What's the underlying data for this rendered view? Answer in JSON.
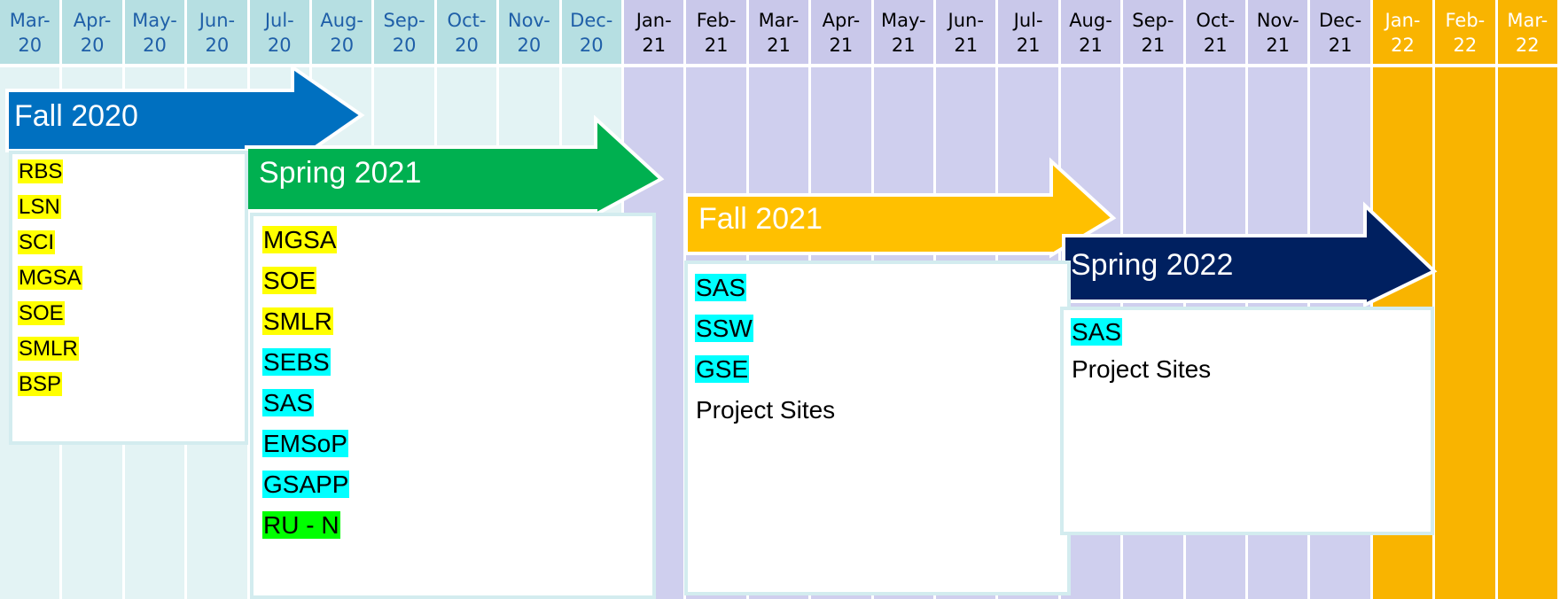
{
  "months": [
    {
      "m": "Mar-",
      "y": "20",
      "period": "2020"
    },
    {
      "m": "Apr-",
      "y": "20",
      "period": "2020"
    },
    {
      "m": "May-",
      "y": "20",
      "period": "2020"
    },
    {
      "m": "Jun-",
      "y": "20",
      "period": "2020"
    },
    {
      "m": "Jul-",
      "y": "20",
      "period": "2020"
    },
    {
      "m": "Aug-",
      "y": "20",
      "period": "2020"
    },
    {
      "m": "Sep-",
      "y": "20",
      "period": "2020"
    },
    {
      "m": "Oct-",
      "y": "20",
      "period": "2020"
    },
    {
      "m": "Nov-",
      "y": "20",
      "period": "2020"
    },
    {
      "m": "Dec-",
      "y": "20",
      "period": "2020"
    },
    {
      "m": "Jan-",
      "y": "21",
      "period": "2021"
    },
    {
      "m": "Feb-",
      "y": "21",
      "period": "2021"
    },
    {
      "m": "Mar-",
      "y": "21",
      "period": "2021"
    },
    {
      "m": "Apr-",
      "y": "21",
      "period": "2021"
    },
    {
      "m": "May-",
      "y": "21",
      "period": "2021"
    },
    {
      "m": "Jun-",
      "y": "21",
      "period": "2021"
    },
    {
      "m": "Jul-",
      "y": "21",
      "period": "2021"
    },
    {
      "m": "Aug-",
      "y": "21",
      "period": "2021"
    },
    {
      "m": "Sep-",
      "y": "21",
      "period": "2021"
    },
    {
      "m": "Oct-",
      "y": "21",
      "period": "2021"
    },
    {
      "m": "Nov-",
      "y": "21",
      "period": "2021"
    },
    {
      "m": "Dec-",
      "y": "21",
      "period": "2021"
    },
    {
      "m": "Jan-",
      "y": "22",
      "period": "2022"
    },
    {
      "m": "Feb-",
      "y": "22",
      "period": "2022"
    },
    {
      "m": "Mar-",
      "y": "22",
      "period": "2022"
    }
  ],
  "colors": {
    "h2020": "#b6dfe2",
    "b2020": "#e3f3f4",
    "t2020": "#1f5fa8",
    "h2021": "#c9c8ea",
    "b2021": "#cfcfee",
    "t2021": "#000000",
    "h2022": "#f9b400",
    "b2022": "#f9b400",
    "t2022": "#ffffff",
    "yellow": "#ffff00",
    "cyan": "#00ffff",
    "green": "#00ff00"
  },
  "phases": [
    {
      "label": "Fall 2020",
      "color": "#0070c0",
      "items": [
        {
          "t": "RBS",
          "h": "yellow"
        },
        {
          "t": "LSN",
          "h": "yellow"
        },
        {
          "t": "SCI",
          "h": "yellow"
        },
        {
          "t": "MGSA",
          "h": "yellow"
        },
        {
          "t": "SOE",
          "h": "yellow"
        },
        {
          "t": "SMLR",
          "h": "yellow"
        },
        {
          "t": "BSP",
          "h": "yellow"
        }
      ]
    },
    {
      "label": "Spring 2021",
      "color": "#00b050",
      "items": [
        {
          "t": "MGSA",
          "h": "yellow"
        },
        {
          "t": "SOE",
          "h": "yellow"
        },
        {
          "t": "SMLR",
          "h": "yellow"
        },
        {
          "t": "SEBS",
          "h": "cyan"
        },
        {
          "t": "SAS",
          "h": "cyan"
        },
        {
          "t": "EMSoP",
          "h": "cyan"
        },
        {
          "t": "GSAPP",
          "h": "cyan"
        },
        {
          "t": "RU - N",
          "h": "green"
        }
      ]
    },
    {
      "label": "Fall 2021",
      "color": "#ffc000",
      "items": [
        {
          "t": "SAS",
          "h": "cyan"
        },
        {
          "t": "SSW",
          "h": "cyan"
        },
        {
          "t": "GSE",
          "h": "cyan"
        },
        {
          "t": "Project Sites",
          "h": ""
        }
      ]
    },
    {
      "label": "Spring 2022",
      "color": "#002060",
      "items": [
        {
          "t": "SAS",
          "h": "cyan"
        },
        {
          "t": "Project Sites",
          "h": ""
        }
      ]
    }
  ]
}
